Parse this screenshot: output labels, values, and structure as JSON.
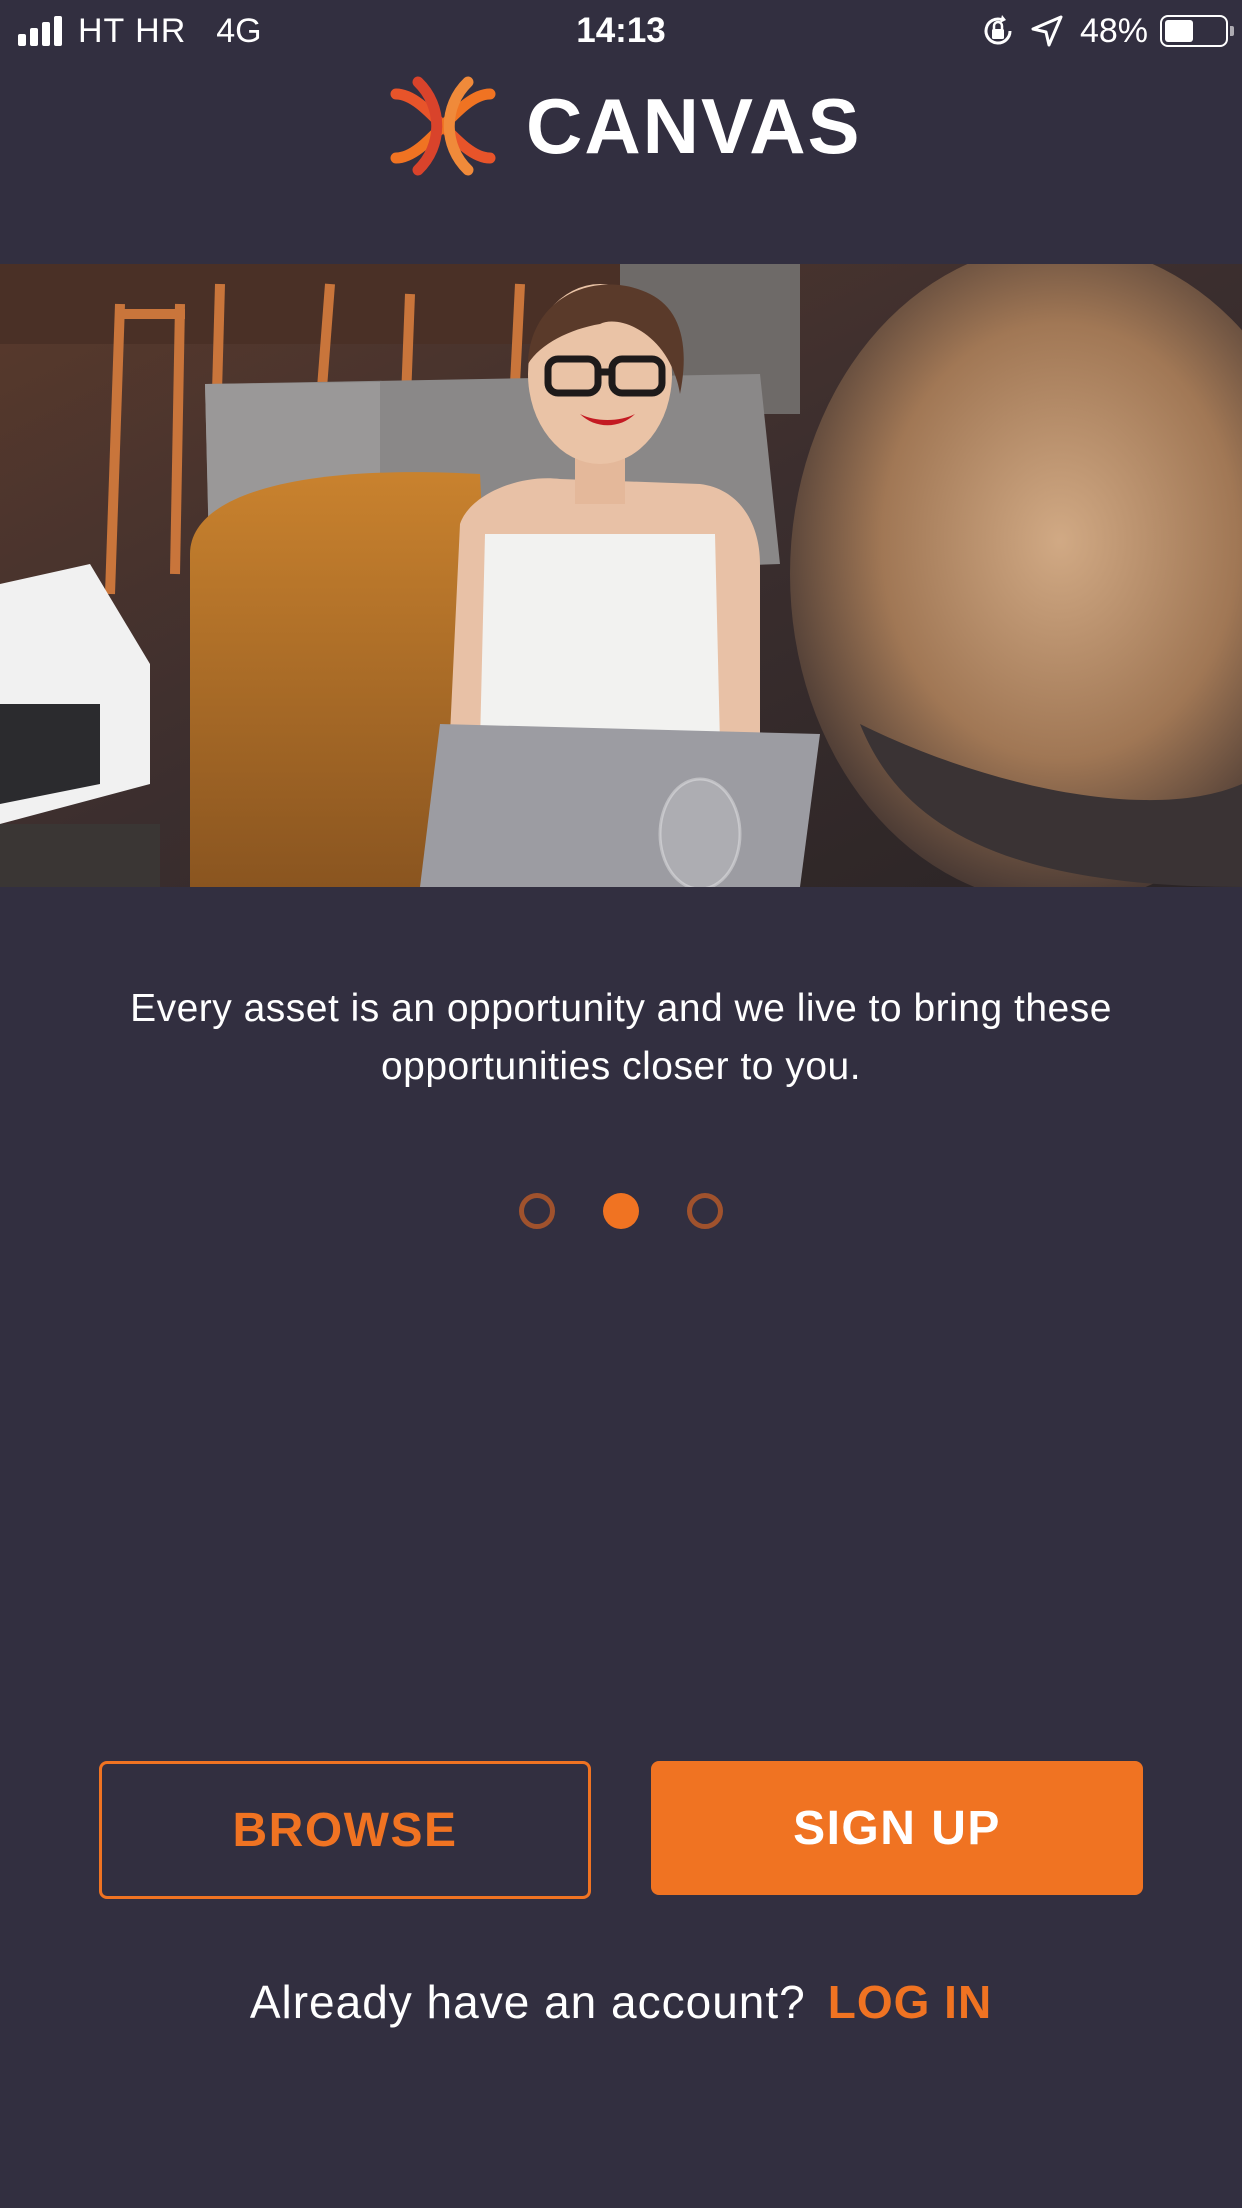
{
  "status_bar": {
    "carrier": "HT HR",
    "network": "4G",
    "time": "14:13",
    "battery_percent": "48%",
    "battery_level": 0.48,
    "icons": [
      "signal-icon",
      "orientation-lock-icon",
      "location-arrow-icon",
      "battery-icon"
    ]
  },
  "logo": {
    "name": "CANVAS",
    "icon": "canvas-logo-icon"
  },
  "hero": {
    "icon": "hero-photo"
  },
  "onboarding": {
    "tagline": "Every asset is an opportunity and we live to bring these opportunities closer to you.",
    "pages_total": 3,
    "active_page": 2
  },
  "actions": {
    "browse_label": "BROWSE",
    "signup_label": "SIGN UP"
  },
  "login": {
    "prompt": "Already have an account?",
    "link_label": "LOG IN"
  },
  "colors": {
    "background": "#322f40",
    "accent": "#f07322",
    "dot_inactive": "#a0522d",
    "text": "#ffffff"
  }
}
